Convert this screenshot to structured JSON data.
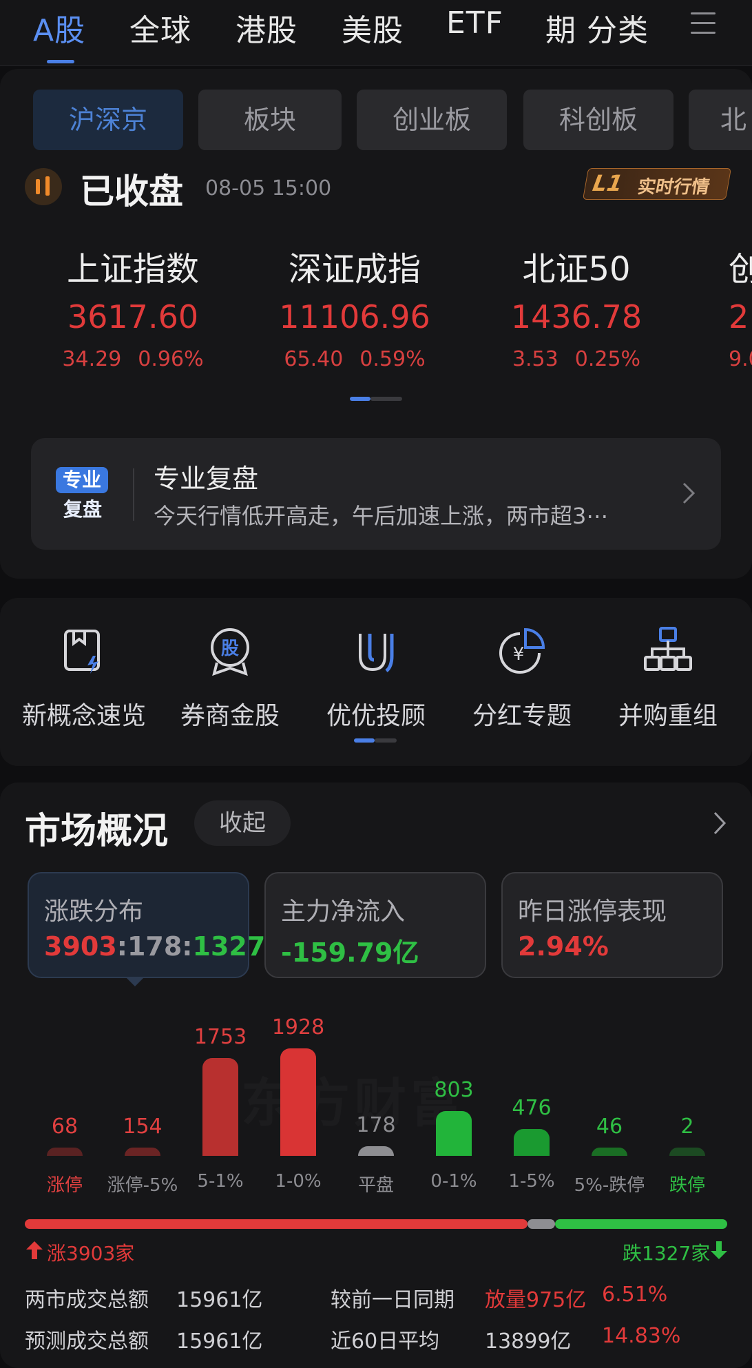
{
  "nav": {
    "tabs": [
      "A股",
      "全球",
      "港股",
      "美股",
      "ETF",
      "期",
      "分类"
    ],
    "active_index": 0
  },
  "subtabs": [
    "沪深京",
    "板块",
    "创业板",
    "科创板",
    "北"
  ],
  "status": {
    "title": "已收盘",
    "time": "08-05  15:00",
    "badge_l1": "L1",
    "badge_label": "实时行情"
  },
  "indices": [
    {
      "name": "上证指数",
      "value": "3617.60",
      "change": "34.29",
      "percent": "0.96%"
    },
    {
      "name": "深证成指",
      "value": "11106.96",
      "change": "65.40",
      "percent": "0.59%"
    },
    {
      "name": "北证50",
      "value": "1436.78",
      "change": "3.53",
      "percent": "0.25%"
    },
    {
      "name": "创",
      "value": "2",
      "change": "9.0",
      "percent": ""
    }
  ],
  "review": {
    "logo_top": "专业",
    "logo_bottom": "复盘",
    "title": "专业复盘",
    "subtitle": "今天行情低开高走，午后加速上涨，两市超3⋯"
  },
  "shortcuts": [
    "新概念速览",
    "券商金股",
    "优优投顾",
    "分红专题",
    "并购重组"
  ],
  "market": {
    "title": "市场概况",
    "collapse_label": "收起",
    "stats": [
      {
        "label": "涨跌分布",
        "up": "3903",
        "flat": "178",
        "down": "1327"
      },
      {
        "label": "主力净流入",
        "value": "-159.79亿"
      },
      {
        "label": "昨日涨停表现",
        "value": "2.94%"
      }
    ],
    "watermark": "东方财富",
    "up_count_label": "涨3903家",
    "down_count_label": "跌1327家",
    "rows": [
      {
        "left_label": "两市成交总额",
        "left_value": "15961亿",
        "right_label": "较前一日同期",
        "right_value": "放量975亿",
        "right_pct": "6.51%"
      },
      {
        "left_label": "预测成交总额",
        "left_value": "15961亿",
        "right_label": "近60日平均",
        "right_value": "13899亿",
        "right_pct": "14.83%"
      }
    ]
  },
  "chart_data": {
    "type": "bar",
    "categories": [
      "涨停",
      "涨停-5%",
      "5-1%",
      "1-0%",
      "平盘",
      "0-1%",
      "1-5%",
      "5%-跌停",
      "跌停"
    ],
    "values": [
      68,
      154,
      1753,
      1928,
      178,
      803,
      476,
      46,
      2
    ],
    "colors": [
      "#5a2222",
      "#6b2424",
      "#b8302f",
      "#d93434",
      "#8e8e92",
      "#22b43a",
      "#1a9a30",
      "#1a6e24",
      "#1c4a22"
    ],
    "label_colors": [
      "#e04040",
      "#e04040",
      "#e04040",
      "#e04040",
      "#8e8e92",
      "#2fbf44",
      "#2fbf44",
      "#2fbf44",
      "#2fbf44"
    ],
    "cat_colors": [
      "#e04040",
      "#8d8d92",
      "#8d8d92",
      "#8d8d92",
      "#8d8d92",
      "#8d8d92",
      "#8d8d92",
      "#8d8d92",
      "#2fbf44"
    ],
    "ylim": [
      0,
      1928
    ]
  },
  "colors": {
    "up": "#e23a3a",
    "down": "#2fbf44",
    "accent": "#4a7fe6"
  }
}
